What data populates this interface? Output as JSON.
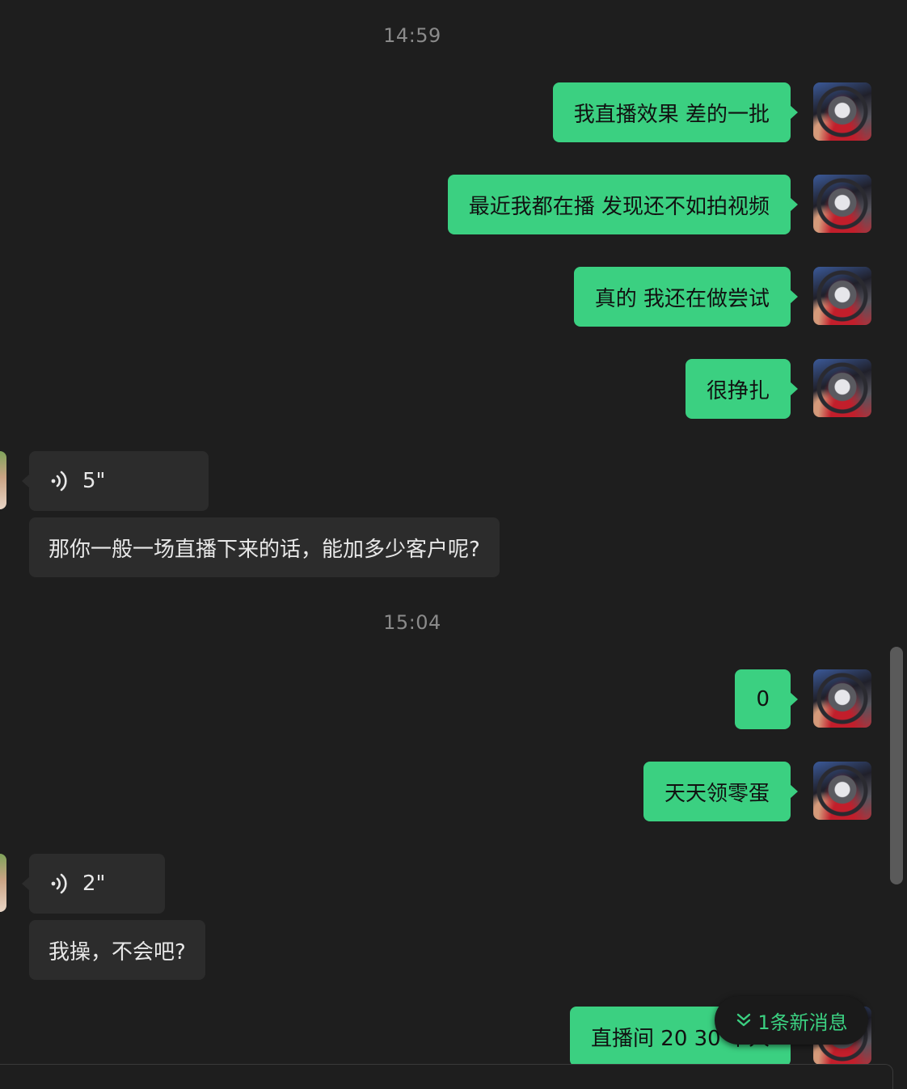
{
  "timestamps": [
    "14:59",
    "15:04"
  ],
  "messages": {
    "out_1": "我直播效果 差的一批",
    "out_2": "最近我都在播 发现还不如拍视频",
    "out_3": "真的  我还在做尝试",
    "out_4": "很挣扎",
    "in_voice_1": "5\"",
    "in_text_1": "那你一般一场直播下来的话，能加多少客户呢?",
    "out_5": "0",
    "out_6": "天天领零蛋",
    "in_voice_2": "2\"",
    "in_text_2": "我操，不会吧?",
    "out_7": "直播间 20 30 个人"
  },
  "new_message_notice": "1条新消息",
  "colors": {
    "background": "#1e1e1e",
    "outgoing_bubble": "#3bd081",
    "incoming_bubble": "#2c2c2c",
    "accent": "#3bd081"
  },
  "icons": {
    "voice": "voice-wave-icon",
    "chevron": "double-chevron-down-icon"
  }
}
